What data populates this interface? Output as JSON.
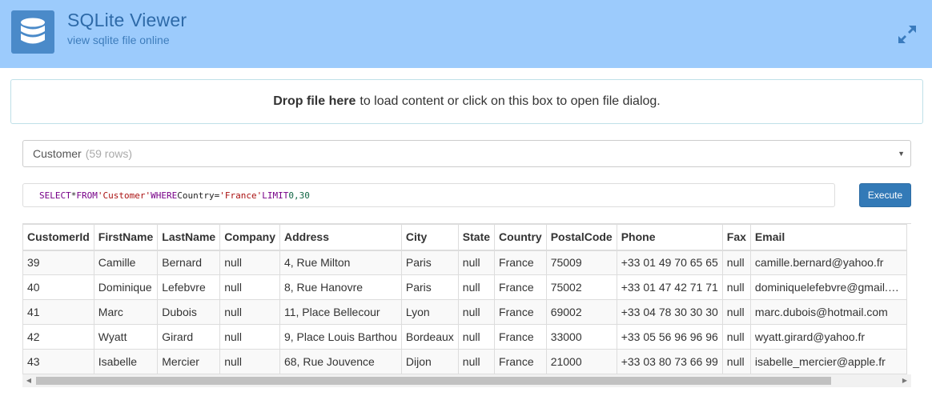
{
  "header": {
    "title": "SQLite Viewer",
    "subtitle": "view sqlite file online",
    "logo_icon": "database-icon",
    "expand_icon": "expand-icon",
    "bg_color": "#9ccbfc",
    "logo_color": "#4a8ac9"
  },
  "dropzone": {
    "bold": "Drop file here",
    "text": "to load content or click on this box to open file dialog."
  },
  "table_select": {
    "selected": "Customer",
    "rows": "(59 rows)"
  },
  "query": {
    "select_kw": "SELECT",
    "star": "*",
    "from_kw": "FROM",
    "table": "'Customer'",
    "where_kw": "WHERE",
    "column": "Country",
    "eq": "=",
    "value": "'France'",
    "limit_kw": "LIMIT",
    "limit": "0,30"
  },
  "execute_label": "Execute",
  "results": {
    "columns": [
      "CustomerId",
      "FirstName",
      "LastName",
      "Company",
      "Address",
      "City",
      "State",
      "Country",
      "PostalCode",
      "Phone",
      "Fax",
      "Email"
    ],
    "rows": [
      [
        "39",
        "Camille",
        "Bernard",
        "null",
        "4, Rue Milton",
        "Paris",
        "null",
        "France",
        "75009",
        "+33 01 49 70 65 65",
        "null",
        "camille.bernard@yahoo.fr"
      ],
      [
        "40",
        "Dominique",
        "Lefebvre",
        "null",
        "8, Rue Hanovre",
        "Paris",
        "null",
        "France",
        "75002",
        "+33 01 47 42 71 71",
        "null",
        "dominiquelefebvre@gmail.c…"
      ],
      [
        "41",
        "Marc",
        "Dubois",
        "null",
        "11, Place Bellecour",
        "Lyon",
        "null",
        "France",
        "69002",
        "+33 04 78 30 30 30",
        "null",
        "marc.dubois@hotmail.com"
      ],
      [
        "42",
        "Wyatt",
        "Girard",
        "null",
        "9, Place Louis Barthou",
        "Bordeaux",
        "null",
        "France",
        "33000",
        "+33 05 56 96 96 96",
        "null",
        "wyatt.girard@yahoo.fr"
      ],
      [
        "43",
        "Isabelle",
        "Mercier",
        "null",
        "68, Rue Jouvence",
        "Dijon",
        "null",
        "France",
        "21000",
        "+33 03 80 73 66 99",
        "null",
        "isabelle_mercier@apple.fr"
      ]
    ]
  },
  "accent_color": "#337ab7"
}
